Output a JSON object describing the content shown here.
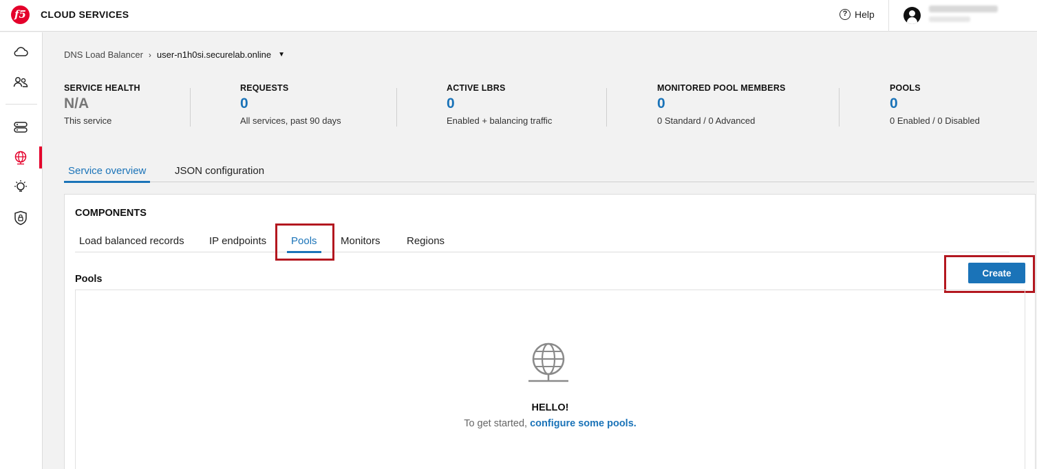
{
  "header": {
    "logo_text": "f5",
    "brand": "CLOUD SERVICES",
    "help_label": "Help",
    "accent_color": "#e4002b"
  },
  "sidebar": {
    "items": [
      {
        "icon": "cloud-icon"
      },
      {
        "icon": "users-icon"
      },
      {
        "icon": "server-icon"
      },
      {
        "icon": "globe-icon",
        "active": true
      },
      {
        "icon": "bulb-icon"
      },
      {
        "icon": "shield-lock-icon"
      }
    ]
  },
  "breadcrumb": {
    "root": "DNS Load Balancer",
    "current": "user-n1h0si.securelab.online"
  },
  "stats": [
    {
      "label": "SERVICE HEALTH",
      "value": "N/A",
      "sub": "This service"
    },
    {
      "label": "REQUESTS",
      "value": "0",
      "sub": "All services, past 90 days"
    },
    {
      "label": "ACTIVE LBRS",
      "value": "0",
      "sub": "Enabled + balancing traffic"
    },
    {
      "label": "MONITORED POOL MEMBERS",
      "value": "0",
      "sub": "0 Standard / 0 Advanced"
    },
    {
      "label": "POOLS",
      "value": "0",
      "sub": "0 Enabled / 0 Disabled"
    }
  ],
  "main_tabs": [
    {
      "label": "Service overview",
      "active": true
    },
    {
      "label": "JSON configuration",
      "active": false
    }
  ],
  "components": {
    "title": "COMPONENTS",
    "tabs": [
      {
        "label": "Load balanced records",
        "active": false
      },
      {
        "label": "IP endpoints",
        "active": false
      },
      {
        "label": "Pools",
        "active": true
      },
      {
        "label": "Monitors",
        "active": false
      },
      {
        "label": "Regions",
        "active": false
      }
    ]
  },
  "pools": {
    "title": "Pools",
    "create_label": "Create",
    "empty_title": "HELLO!",
    "empty_text": "To get started,",
    "empty_link": "configure some pools."
  },
  "colors": {
    "primary": "#1a73b8",
    "highlight": "#b3171f"
  }
}
